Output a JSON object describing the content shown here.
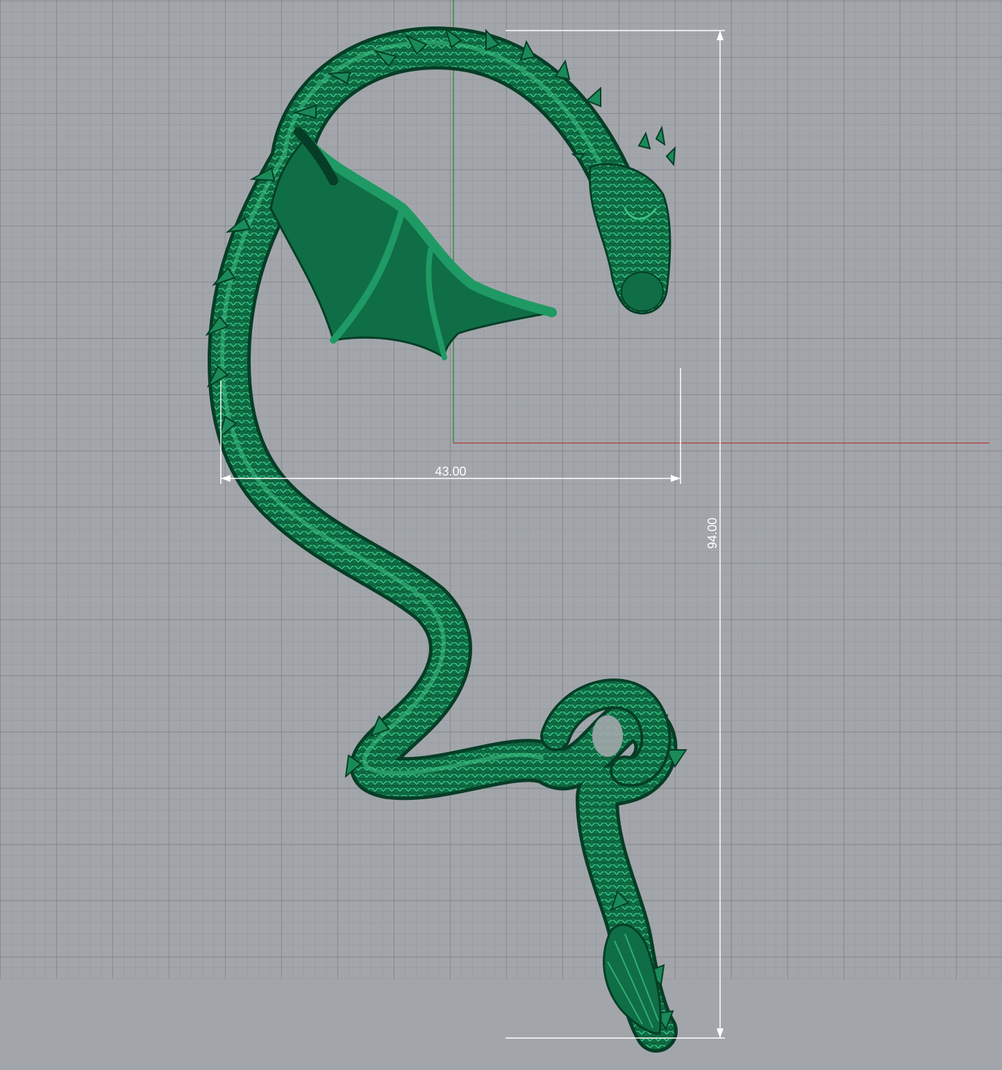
{
  "viewport": {
    "background": "#a2a6ab",
    "grid_color": "#878b91",
    "x_axis_color": "#b0484a",
    "y_axis_color": "#3f8a46"
  },
  "model": {
    "color": "#0f6e45",
    "highlight": "#2fae74",
    "shadow": "#063d26"
  },
  "dimensions": {
    "width_label": "43.00",
    "height_label": "94.00",
    "line_color": "#ffffff"
  }
}
